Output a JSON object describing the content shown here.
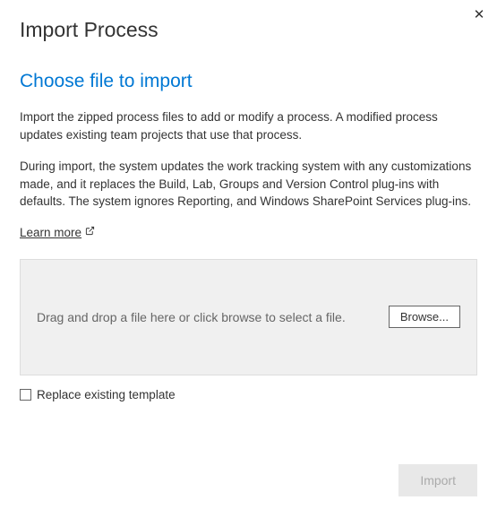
{
  "title": "Import Process",
  "subtitle": "Choose file to import",
  "description1": "Import the zipped process files to add or modify a process. A modified process updates existing team projects that use that process.",
  "description2": "During import, the system updates the work tracking system with any customizations made, and it replaces the Build, Lab, Groups and Version Control plug-ins with defaults. The system ignores Reporting, and Windows SharePoint Services plug-ins.",
  "learn_more": "Learn more",
  "dropzone": {
    "text": "Drag and drop a file here or click browse to select a file.",
    "browse_label": "Browse..."
  },
  "checkbox": {
    "label": "Replace existing template",
    "checked": false
  },
  "footer": {
    "import_label": "Import"
  }
}
